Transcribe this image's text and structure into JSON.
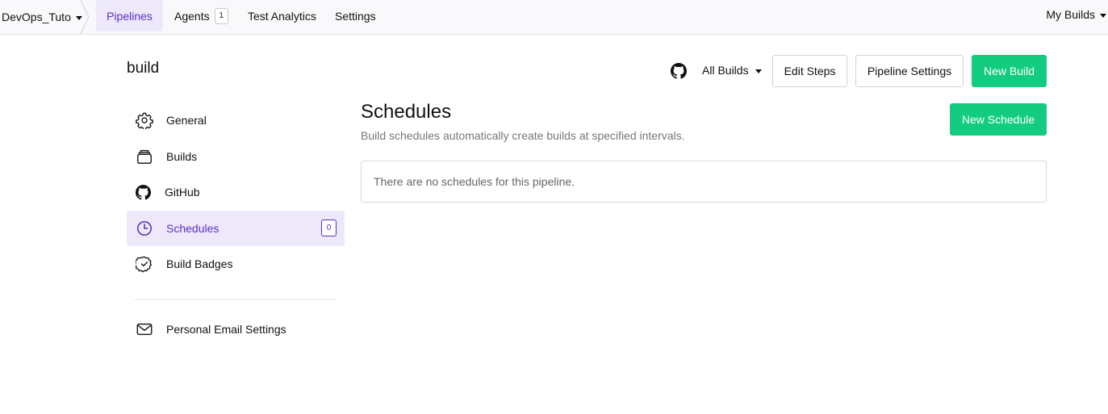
{
  "topnav": {
    "org_name": "DevOps_Tuto",
    "items": [
      {
        "label": "Pipelines",
        "active": true
      },
      {
        "label": "Agents",
        "badge": "1"
      },
      {
        "label": "Test Analytics"
      },
      {
        "label": "Settings"
      }
    ],
    "my_builds": "My Builds"
  },
  "header": {
    "pipeline_name": "build",
    "repo_icon": "github-icon",
    "filter_label": "All Builds",
    "edit_steps": "Edit Steps",
    "pipeline_settings": "Pipeline Settings",
    "new_build": "New Build"
  },
  "sidebar": {
    "items": [
      {
        "label": "General",
        "icon": "gear-icon"
      },
      {
        "label": "Builds",
        "icon": "builds-stack-icon"
      },
      {
        "label": "GitHub",
        "icon": "github-icon"
      },
      {
        "label": "Schedules",
        "icon": "clock-icon",
        "active": true,
        "badge": "0"
      },
      {
        "label": "Build Badges",
        "icon": "badge-check-icon"
      }
    ],
    "secondary": [
      {
        "label": "Personal Email Settings",
        "icon": "envelope-icon"
      }
    ]
  },
  "main": {
    "title": "Schedules",
    "description": "Build schedules automatically create builds at specified intervals.",
    "new_schedule": "New Schedule",
    "empty_message": "There are no schedules for this pipeline."
  },
  "colors": {
    "accent_purple": "#5a2fc2",
    "active_bg": "#ede9fb",
    "primary_green": "#14cc80",
    "nav_bg": "#f9f9fb"
  }
}
